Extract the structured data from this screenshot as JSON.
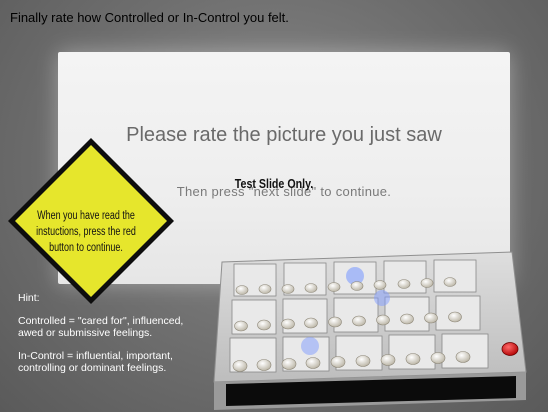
{
  "top_instruction": "Finally rate how Controlled or In-Control you felt.",
  "screen": {
    "title": "Please rate the picture you just saw",
    "subtitle": "Then press \"next slide\" to continue."
  },
  "warning_sign": {
    "title": "Test Slide Only.",
    "body": "When you have read the instuctions, press the red button to continue."
  },
  "hint": {
    "label": "Hint:",
    "controlled": "Controlled = \"cared for\", influenced, awed or submissive feelings.",
    "in_control": "In-Control = influential, important, controlling or dominant feelings."
  },
  "colors": {
    "sign_yellow": "#e8e62a",
    "console_body": "#cfcfcf",
    "red_button": "#d01818",
    "highlight_blue": "#7f9cff"
  }
}
